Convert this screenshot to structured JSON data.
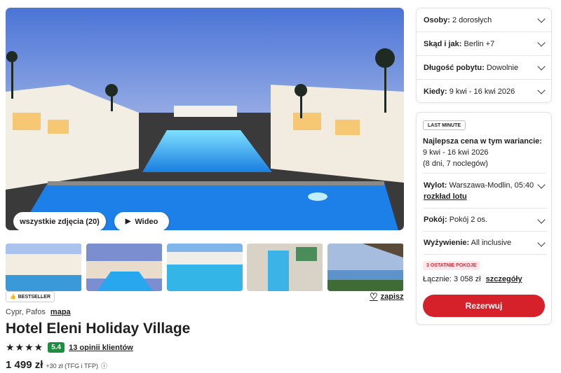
{
  "gallery": {
    "all_photos_label": "wszystkie zdjęcia (20)",
    "video_label": "Wideo"
  },
  "hotel": {
    "bestseller": "BESTSELLER",
    "save": "zapisz",
    "location": "Cypr, Pafos",
    "map_link": "mapa",
    "name": "Hotel Eleni Holiday Village",
    "stars": "★★★★",
    "score": "5.4",
    "reviews": "13 opinii klientów",
    "price": "1 499 zł",
    "price_extra": "+30 zł (TFG i TFP)"
  },
  "filters": {
    "persons_label": "Osoby:",
    "persons_value": "2 dorosłych",
    "from_label": "Skąd i jak:",
    "from_value": "Berlin +7",
    "length_label": "Długość pobytu:",
    "length_value": "Dowolnie",
    "when_label": "Kiedy:",
    "when_value": "9 kwi - 16 kwi 2026"
  },
  "offer": {
    "badge": "LAST MINUTE",
    "best_price_heading": "Najlepsza cena w tym wariancie:",
    "dates": "9 kwi - 16 kwi 2026",
    "duration": "(8 dni, 7 noclegów)",
    "flight_label": "Wylot:",
    "flight_value": "Warszawa-Modlin, 05:40",
    "schedule_link": "rozkład lotu",
    "room_label": "Pokój:",
    "room_value": "Pokój 2 os.",
    "board_label": "Wyżywienie:",
    "board_value": "All inclusive",
    "rooms_left": "3 OSTATNIE POKOJE",
    "total_label": "Łącznie: 3 058 zł",
    "details_link": "szczegóły",
    "book_button": "Rezerwuj"
  },
  "colors": {
    "accent": "#d6202a",
    "score_green": "#1b8f3d"
  }
}
